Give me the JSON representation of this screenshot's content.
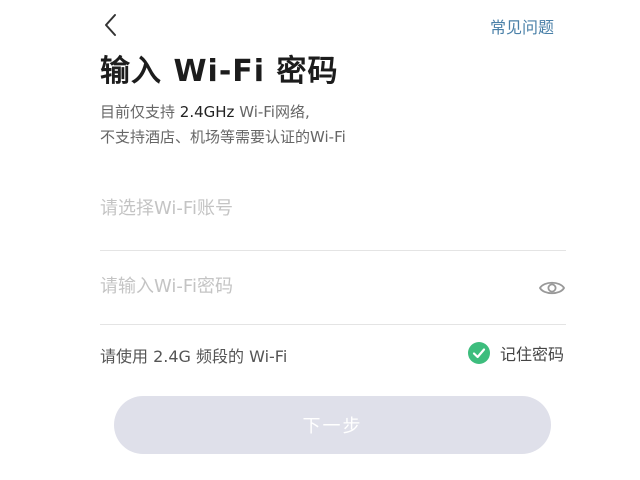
{
  "header": {
    "faq_label": "常见问题"
  },
  "title": "输入 Wi-Fi 密码",
  "description": {
    "line1_prefix": "目前仅支持 ",
    "line1_highlight": "2.4GHz",
    "line1_suffix": " Wi-Fi网络,",
    "line2": "不支持酒店、机场等需要认证的Wi-Fi"
  },
  "form": {
    "ssid_placeholder": "请选择Wi-Fi账号",
    "ssid_value": "",
    "password_placeholder": "请输入Wi-Fi密码",
    "password_value": "",
    "hint": "请使用 2.4G 频段的 Wi-Fi",
    "remember_label": "记住密码",
    "remember_checked": true,
    "next_label": "下一步"
  },
  "colors": {
    "link": "#4a80a8",
    "check": "#3dbd7d",
    "button_disabled": "#dfe0ea"
  },
  "icons": {
    "back": "chevron-left-icon",
    "eye": "eye-icon",
    "check": "check-circle-icon"
  }
}
